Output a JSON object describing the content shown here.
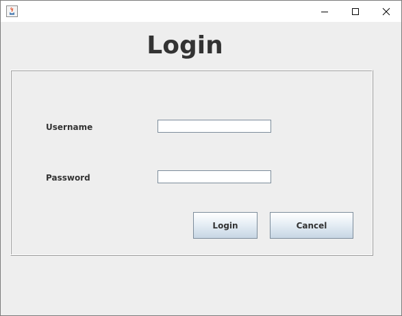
{
  "window": {
    "title_text": "",
    "controls": {
      "minimize": "minimize-icon",
      "maximize": "maximize-icon",
      "close": "close-icon"
    }
  },
  "header": {
    "title": "Login"
  },
  "form": {
    "username_label": "Username",
    "username_value": "",
    "password_label": "Password",
    "password_value": "",
    "login_button": "Login",
    "cancel_button": "Cancel"
  },
  "colors": {
    "background": "#eeeeee",
    "titlebar": "#ffffff",
    "text": "#333333",
    "button_gradient_top": "#ffffff",
    "button_gradient_bottom": "#c7d6e4"
  }
}
